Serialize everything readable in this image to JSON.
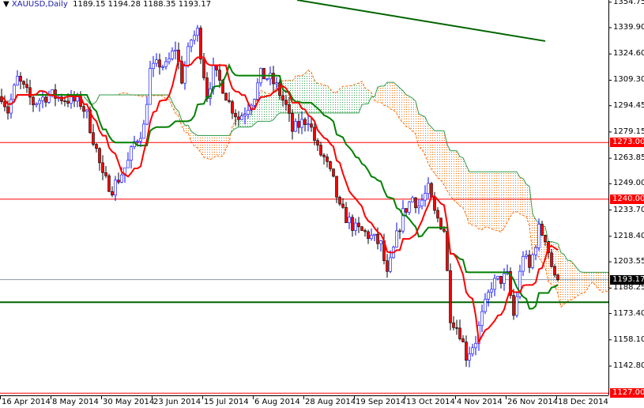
{
  "header": {
    "menu_icon": "triangle-down-icon",
    "symbol": "XAUUSD,Daily",
    "ohlc": "1189.15 1194.28 1188.35 1193.17"
  },
  "colors": {
    "bear_body": "#ff0000",
    "bull_wick": "#0000ff",
    "tenkan": "#ff0000",
    "kijun": "#008000",
    "cloud_bull": "#2e9e4a",
    "cloud_bear": "#ff6a00",
    "hline_red": "#ff0000",
    "hline_green": "#006400",
    "price_line": "#8a9aa8"
  },
  "chart_data": {
    "type": "candlestick",
    "title": "XAUUSD,Daily",
    "indicator": "Ichimoku Kinko Hyo (9,26,52)",
    "ylim": [
      1127.0,
      1358.0
    ],
    "y_ticks": [
      "1354.75",
      "1339.90",
      "1324.60",
      "1309.30",
      "1294.45",
      "1279.15",
      "1263.85",
      "1249.00",
      "1233.70",
      "1218.40",
      "1203.55",
      "1188.25",
      "1173.40",
      "1158.10",
      "1142.80"
    ],
    "x_ticks": [
      "16 Apr 2014",
      "8 May 2014",
      "30 May 2014",
      "23 Jun 2014",
      "15 Jul 2014",
      "6 Aug 2014",
      "28 Aug 2014",
      "19 Sep 2014",
      "13 Oct 2014",
      "4 Nov 2014",
      "26 Nov 2014",
      "18 Dec 2014"
    ],
    "close_keypoints": [
      [
        0,
        1300.8
      ],
      [
        2,
        1291.5
      ],
      [
        5,
        1310
      ],
      [
        10,
        1296
      ],
      [
        15,
        1301
      ],
      [
        20,
        1298.5
      ],
      [
        25,
        1296
      ],
      [
        27,
        1289
      ],
      [
        30,
        1268.5
      ],
      [
        32,
        1252.4
      ],
      [
        35,
        1246.4
      ],
      [
        37,
        1252
      ],
      [
        40,
        1261.6
      ],
      [
        42,
        1273
      ],
      [
        45,
        1282
      ],
      [
        47,
        1314.6
      ],
      [
        50,
        1319
      ],
      [
        52,
        1317
      ],
      [
        55,
        1328.4
      ],
      [
        57,
        1310
      ],
      [
        60,
        1333
      ],
      [
        62,
        1337.6
      ],
      [
        65,
        1300.8
      ],
      [
        67,
        1314.6
      ],
      [
        70,
        1305.4
      ],
      [
        72,
        1296
      ],
      [
        75,
        1287
      ],
      [
        77,
        1291.6
      ],
      [
        80,
        1300.8
      ],
      [
        82,
        1312.3
      ],
      [
        85,
        1310
      ],
      [
        87,
        1305.4
      ],
      [
        90,
        1293.8
      ],
      [
        92,
        1280
      ],
      [
        95,
        1284.6
      ],
      [
        97,
        1287
      ],
      [
        100,
        1268.5
      ],
      [
        102,
        1264
      ],
      [
        105,
        1250
      ],
      [
        107,
        1234
      ],
      [
        110,
        1227
      ],
      [
        112,
        1222.5
      ],
      [
        115,
        1220.2
      ],
      [
        117,
        1217.9
      ],
      [
        120,
        1213.3
      ],
      [
        122,
        1195
      ],
      [
        125,
        1218
      ],
      [
        127,
        1231.7
      ],
      [
        130,
        1241
      ],
      [
        132,
        1236.3
      ],
      [
        135,
        1245.5
      ],
      [
        137,
        1231.7
      ],
      [
        140,
        1222.5
      ],
      [
        142,
        1172
      ],
      [
        145,
        1162.6
      ],
      [
        147,
        1148.8
      ],
      [
        150,
        1158
      ],
      [
        152,
        1172
      ],
      [
        155,
        1190.2
      ],
      [
        157,
        1192.5
      ],
      [
        160,
        1195
      ],
      [
        162,
        1172
      ],
      [
        165,
        1208.6
      ],
      [
        167,
        1199.4
      ],
      [
        170,
        1222.5
      ],
      [
        172,
        1218
      ],
      [
        175,
        1193.2
      ],
      [
        176,
        1193.17
      ]
    ],
    "horizontal_lines": [
      {
        "price": 1273.0,
        "label": "1273.00",
        "color": "red"
      },
      {
        "price": 1240.0,
        "label": "1240.00",
        "color": "red"
      },
      {
        "price": 1127.0,
        "label": "1127.00",
        "color": "red"
      },
      {
        "price": 1180.0,
        "color": "green"
      }
    ],
    "current_price": {
      "price": 1193.17,
      "label": "1193.17"
    },
    "trendline": {
      "from": [
        93.5,
        1356.0
      ],
      "to": [
        172,
        1332.1
      ]
    }
  }
}
